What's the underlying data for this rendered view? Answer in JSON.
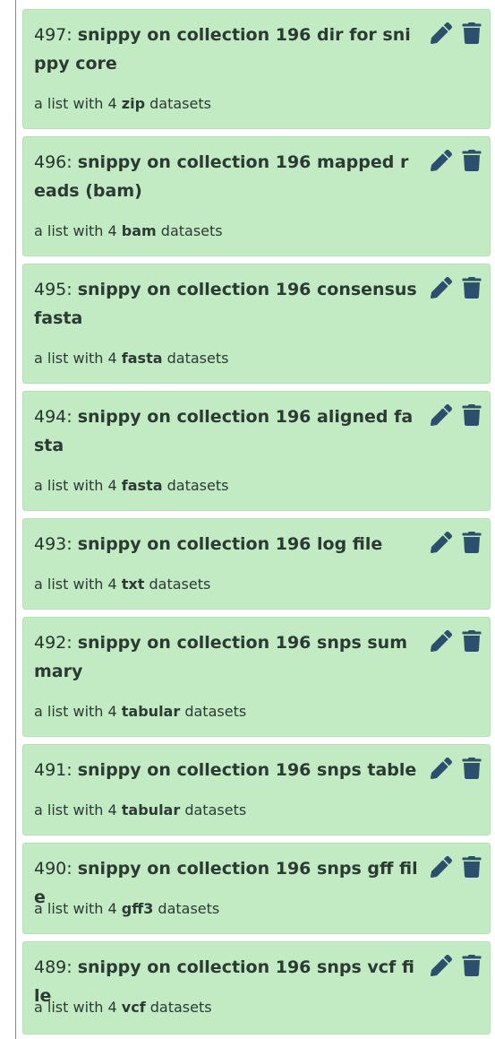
{
  "colors": {
    "card_background": "#c3ebc3",
    "icon": "#2c4f6e",
    "text": "#27352f"
  },
  "collections": [
    {
      "hid": "497",
      "name": "snippy on collection 196 dir for snippy core",
      "desc_prefix": "a list with 4",
      "ext": "zip",
      "desc_suffix": "datasets",
      "edit_icon": "pencil-icon",
      "delete_icon": "trash-icon"
    },
    {
      "hid": "496",
      "name": "snippy on collection 196 mapped reads (bam)",
      "desc_prefix": "a list with 4",
      "ext": "bam",
      "desc_suffix": "datasets",
      "edit_icon": "pencil-icon",
      "delete_icon": "trash-icon"
    },
    {
      "hid": "495",
      "name": "snippy on collection 196 consensus fasta",
      "desc_prefix": "a list with 4",
      "ext": "fasta",
      "desc_suffix": "datasets",
      "edit_icon": "pencil-icon",
      "delete_icon": "trash-icon"
    },
    {
      "hid": "494",
      "name": "snippy on collection 196 aligned fasta",
      "desc_prefix": "a list with 4",
      "ext": "fasta",
      "desc_suffix": "datasets",
      "edit_icon": "pencil-icon",
      "delete_icon": "trash-icon"
    },
    {
      "hid": "493",
      "name": "snippy on collection 196 log file",
      "desc_prefix": "a list with 4",
      "ext": "txt",
      "desc_suffix": "datasets",
      "edit_icon": "pencil-icon",
      "delete_icon": "trash-icon"
    },
    {
      "hid": "492",
      "name": "snippy on collection 196 snps summary",
      "desc_prefix": "a list with 4",
      "ext": "tabular",
      "desc_suffix": "datasets",
      "edit_icon": "pencil-icon",
      "delete_icon": "trash-icon"
    },
    {
      "hid": "491",
      "name": "snippy on collection 196 snps table",
      "desc_prefix": "a list with 4",
      "ext": "tabular",
      "desc_suffix": "datasets",
      "edit_icon": "pencil-icon",
      "delete_icon": "trash-icon"
    },
    {
      "hid": "490",
      "name": "snippy on collection 196 snps gff file",
      "desc_prefix": "a list with 4",
      "ext": "gff3",
      "desc_suffix": "datasets",
      "edit_icon": "pencil-icon",
      "delete_icon": "trash-icon"
    },
    {
      "hid": "489",
      "name": "snippy on collection 196 snps vcf file",
      "desc_prefix": "a list with 4",
      "ext": "vcf",
      "desc_suffix": "datasets",
      "edit_icon": "pencil-icon",
      "delete_icon": "trash-icon"
    }
  ]
}
